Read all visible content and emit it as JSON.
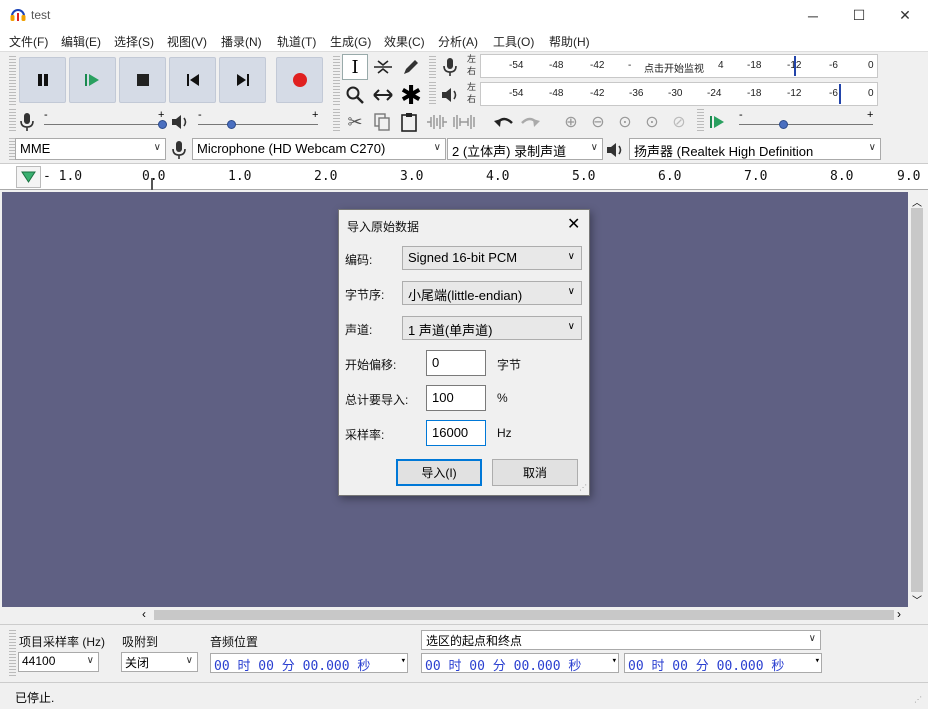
{
  "window": {
    "title": "test",
    "minimize_glyph": "─",
    "maximize_glyph": "☐",
    "close_glyph": "✕"
  },
  "menu": [
    "文件(F)",
    "编辑(E)",
    "选择(S)",
    "视图(V)",
    "播录(N)",
    "轨道(T)",
    "生成(G)",
    "效果(C)",
    "分析(A)",
    "工具(O)",
    "帮助(H)"
  ],
  "meters": {
    "rec_channel_top": "左",
    "rec_channel_bottom": "右",
    "rec_ticks": [
      "-54",
      "-48",
      "-42",
      "-",
      "4",
      "-18",
      "-12",
      "-6",
      "0"
    ],
    "rec_hint": "点击开始监视",
    "play_channel_top": "左",
    "play_channel_bottom": "右",
    "play_ticks": [
      "-54",
      "-48",
      "-42",
      "-36",
      "-30",
      "-24",
      "-18",
      "-12",
      "-6",
      "0"
    ]
  },
  "mixer": {
    "rec_minus": "-",
    "rec_plus": "+",
    "play_minus": "-",
    "play_plus": "+",
    "speed_minus": "-",
    "speed_plus": "+"
  },
  "devices": {
    "host": "MME",
    "recording_device": "Microphone (HD Webcam C270)",
    "channels": "2 (立体声) 录制声道",
    "playback_device": "扬声器 (Realtek High Definition"
  },
  "ruler_labels": [
    "- 1.0",
    "0.0",
    "1.0",
    "2.0",
    "3.0",
    "4.0",
    "5.0",
    "6.0",
    "7.0",
    "8.0",
    "9.0"
  ],
  "dialog": {
    "title": "导入原始数据",
    "encoding_label": "编码:",
    "encoding_value": "Signed 16-bit PCM",
    "byte_order_label": "字节序:",
    "byte_order_value": "小尾端(little-endian)",
    "channels_label": "声道:",
    "channels_value": "1 声道(单声道)",
    "offset_label": "开始偏移:",
    "offset_value": "0",
    "offset_unit": "字节",
    "amount_label": "总计要导入:",
    "amount_value": "100",
    "amount_unit": "%",
    "rate_label": "采样率:",
    "rate_value": "16000",
    "rate_unit": "Hz",
    "import_button": "导入(I)",
    "cancel_button": "取消"
  },
  "selection_bar": {
    "project_rate_label": "项目采样率 (Hz)",
    "project_rate_value": "44100",
    "snap_label": "吸附到",
    "snap_value": "关闭",
    "audio_position_label": "音频位置",
    "audio_position_value": "00 时 00 分 00.000 秒",
    "selection_mode": "选区的起点和终点",
    "selection_start": "00 时 00 分 00.000 秒",
    "selection_end": "00 时 00 分 00.000 秒"
  },
  "status": "已停止."
}
